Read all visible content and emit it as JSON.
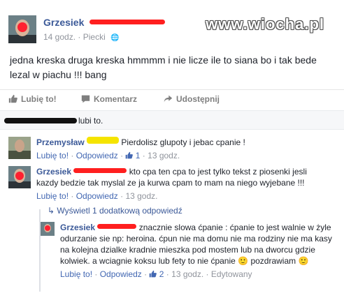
{
  "watermark": "www.wiocha.pl",
  "post": {
    "author": "Grzesiek",
    "time": "14 godz.",
    "location": "Piecki",
    "text": "jedna kreska druga kreska hmmmm i nie licze ile to siana bo i tak bede lezal w piachu !!! bang"
  },
  "actions": {
    "like": "Lubię to!",
    "comment": "Komentarz",
    "share": "Udostępnij"
  },
  "likes": {
    "suffix": "lubi to."
  },
  "comments": [
    {
      "author": "Przemysław",
      "text": "Pierdolisz glupoty i jebac cpanie !",
      "like": "Lubię to!",
      "reply": "Odpowiedz",
      "count": "1",
      "time": "13 godz."
    },
    {
      "author": "Grzesiek",
      "text": "kto cpa ten cpa to jest tylko tekst z piosenki jesli kazdy bedzie tak myslal ze ja kurwa cpam to mam na niego wyjebane !!!",
      "like": "Lubię to!",
      "reply": "Odpowiedz",
      "time": "13 godz."
    }
  ],
  "more_replies": "Wyświetl 1 dodatkową odpowiedź",
  "reply": {
    "author": "Grzesiek",
    "text": "znacznie slowa ćpanie : ćpanie to jest walnie w żyle odurzanie sie np: heroina. ćpun nie ma domu nie ma rodziny nie ma kasy na kolejna dzialke kradnie mieszka pod mostem lub na dworcu gdzie kolwiek. a wciagnie koksu lub fety to nie ćpanie",
    "tail": "pozdrawiam",
    "like": "Lubię to!",
    "reply": "Odpowiedz",
    "count": "2",
    "time": "13 godz.",
    "edited": "Edytowany"
  },
  "colors": {
    "link": "#3b5998",
    "redaction": "#ff1f1f",
    "highlight": "#f5e400"
  }
}
